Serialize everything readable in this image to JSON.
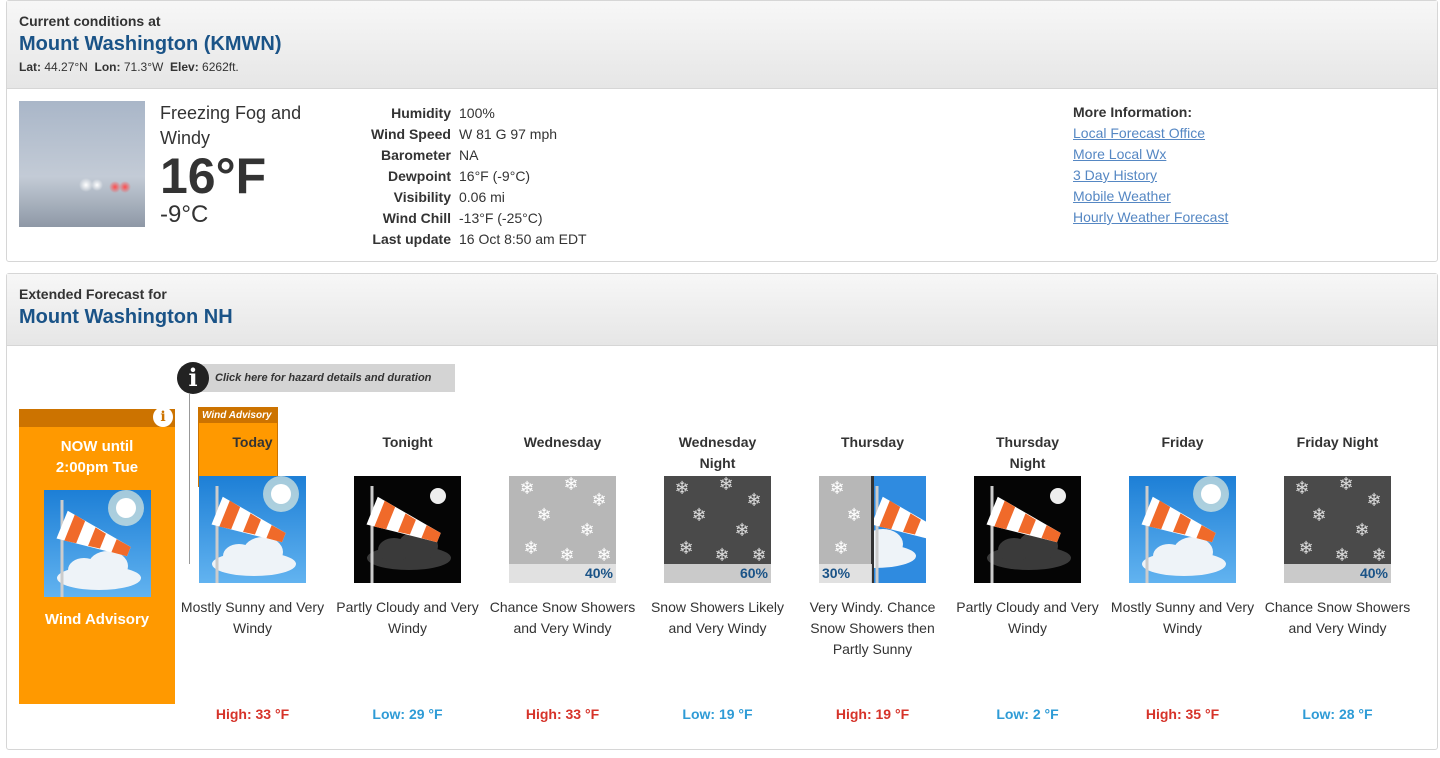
{
  "current": {
    "header_small": "Current conditions at",
    "station": "Mount Washington (KMWN)",
    "lat_label": "Lat:",
    "lat": "44.27°N",
    "lon_label": "Lon:",
    "lon": "71.3°W",
    "elev_label": "Elev:",
    "elev": "6262ft.",
    "condition": "Freezing Fog and Windy",
    "temp_f": "16°F",
    "temp_c": "-9°C",
    "details": [
      {
        "label": "Humidity",
        "value": "100%"
      },
      {
        "label": "Wind Speed",
        "value": "W 81 G 97 mph"
      },
      {
        "label": "Barometer",
        "value": "NA"
      },
      {
        "label": "Dewpoint",
        "value": "16°F (-9°C)"
      },
      {
        "label": "Visibility",
        "value": "0.06 mi"
      },
      {
        "label": "Wind Chill",
        "value": "-13°F (-25°C)"
      },
      {
        "label": "Last update",
        "value": "16 Oct 8:50 am EDT"
      }
    ],
    "more_title": "More Information:",
    "links": [
      "Local Forecast Office",
      "More Local Wx",
      "3 Day History",
      "Mobile Weather",
      "Hourly Weather Forecast"
    ]
  },
  "extended": {
    "header_small": "Extended Forecast for",
    "location": "Mount Washington NH",
    "hazard_button": "Click here for hazard details and duration",
    "now": {
      "title_line1": "NOW until",
      "title_line2": "2:00pm Tue",
      "desc": "Wind Advisory"
    },
    "advisory_tag": "Wind Advisory",
    "periods": [
      {
        "name": "Today",
        "icon": "wind-sunny-icon",
        "pop": "",
        "desc": "Mostly Sunny and Very Windy",
        "temp": "High: 33 °F",
        "kind": "hi"
      },
      {
        "name": "Tonight",
        "icon": "wind-night-icon",
        "pop": "",
        "desc": "Partly Cloudy and Very Windy",
        "temp": "Low: 29 °F",
        "kind": "lo"
      },
      {
        "name": "Wednesday",
        "icon": "snow-day-icon",
        "pop": "40%",
        "desc": "Chance Snow Showers and Very Windy",
        "temp": "High: 33 °F",
        "kind": "hi"
      },
      {
        "name": "Wednesday Night",
        "icon": "snow-night-icon",
        "pop": "60%",
        "desc": "Snow Showers Likely and Very Windy",
        "temp": "Low: 19 °F",
        "kind": "lo"
      },
      {
        "name": "Thursday",
        "icon": "snow-to-wind-icon",
        "pop": "30%",
        "desc": "Very Windy. Chance Snow Showers then Partly Sunny",
        "temp": "High: 19 °F",
        "kind": "hi"
      },
      {
        "name": "Thursday Night",
        "icon": "wind-night-icon",
        "pop": "",
        "desc": "Partly Cloudy and Very Windy",
        "temp": "Low: 2 °F",
        "kind": "lo"
      },
      {
        "name": "Friday",
        "icon": "wind-sunny-icon",
        "pop": "",
        "desc": "Mostly Sunny and Very Windy",
        "temp": "High: 35 °F",
        "kind": "hi"
      },
      {
        "name": "Friday Night",
        "icon": "snow-night-icon",
        "pop": "40%",
        "desc": "Chance Snow Showers and Very Windy",
        "temp": "Low: 28 °F",
        "kind": "lo"
      }
    ]
  },
  "colors": {
    "link": "#5587c3",
    "title": "#1a5387",
    "high": "#d6332a",
    "low": "#2e9bd6",
    "advisory": "#ff9900"
  }
}
